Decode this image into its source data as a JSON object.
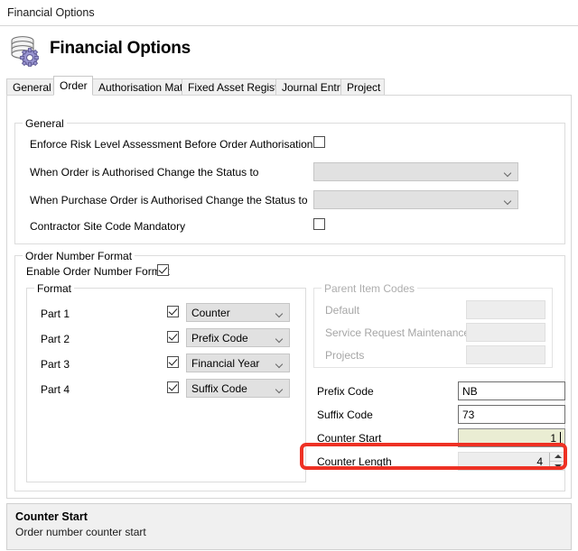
{
  "window": {
    "title": "Financial Options"
  },
  "header": {
    "title": "Financial Options",
    "icon": "database-gear-icon"
  },
  "tabs": [
    {
      "label": "General",
      "active": false
    },
    {
      "label": "Order",
      "active": true
    },
    {
      "label": "Authorisation Matrix",
      "active": false
    },
    {
      "label": "Fixed Asset Register",
      "active": false
    },
    {
      "label": "Journal Entry",
      "active": false
    },
    {
      "label": "Project",
      "active": false
    }
  ],
  "general_group": {
    "legend": "General",
    "rows": [
      {
        "label": "Enforce Risk Level Assessment Before Order Authorisation",
        "control": "checkbox",
        "checked": false
      },
      {
        "label": "When Order is Authorised Change the Status to",
        "control": "combo",
        "value": "",
        "enabled": false
      },
      {
        "label": "When Purchase Order is Authorised Change the Status to",
        "control": "combo",
        "value": "",
        "enabled": false
      },
      {
        "label": "Contractor Site Code Mandatory",
        "control": "checkbox",
        "checked": false
      }
    ]
  },
  "order_number_format": {
    "legend": "Order Number Format",
    "enable_label": "Enable Order Number Format",
    "enable_checked": true,
    "format_group": {
      "legend": "Format",
      "parts": [
        {
          "label": "Part 1",
          "checked": true,
          "value": "Counter"
        },
        {
          "label": "Part 2",
          "checked": true,
          "value": "Prefix Code"
        },
        {
          "label": "Part 3",
          "checked": true,
          "value": "Financial Year"
        },
        {
          "label": "Part 4",
          "checked": true,
          "value": "Suffix Code"
        }
      ]
    },
    "parent_item_codes": {
      "legend": "Parent Item Codes",
      "enabled": false,
      "rows": [
        {
          "label": "Default",
          "value": ""
        },
        {
          "label": "Service Request Maintenance",
          "value": ""
        },
        {
          "label": "Projects",
          "value": ""
        }
      ]
    },
    "codes": [
      {
        "label": "Prefix Code",
        "value": "NB",
        "type": "text",
        "focused": false,
        "align": "left"
      },
      {
        "label": "Suffix Code",
        "value": "73",
        "type": "text",
        "focused": false,
        "align": "left"
      },
      {
        "label": "Counter Start",
        "value": "1",
        "type": "text",
        "focused": true,
        "align": "right"
      },
      {
        "label": "Counter Length",
        "value": "4",
        "type": "spinner",
        "focused": false,
        "align": "right"
      }
    ]
  },
  "highlight": {
    "target": "Counter Start",
    "color": "#ee3124"
  },
  "help_panel": {
    "title": "Counter Start",
    "description": "Order number counter start"
  }
}
